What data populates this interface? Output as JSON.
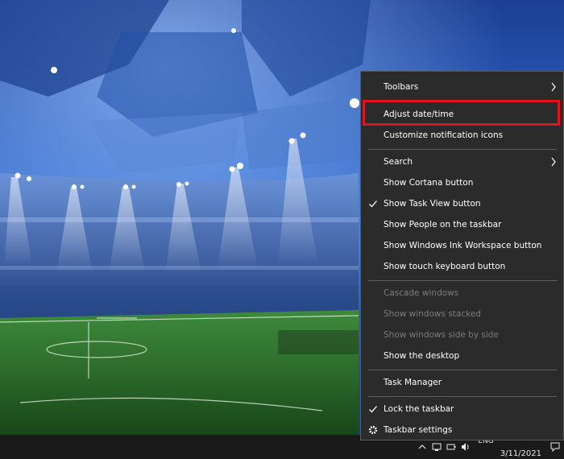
{
  "context_menu": {
    "items": [
      {
        "label": "Toolbars",
        "submenu": true
      },
      {
        "label": "Adjust date/time",
        "highlighted": true
      },
      {
        "label": "Customize notification icons"
      },
      {
        "label": "Search",
        "submenu": true
      },
      {
        "label": "Show Cortana button"
      },
      {
        "label": "Show Task View button",
        "checked": true
      },
      {
        "label": "Show People on the taskbar"
      },
      {
        "label": "Show Windows Ink Workspace button"
      },
      {
        "label": "Show touch keyboard button"
      },
      {
        "label": "Cascade windows",
        "disabled": true
      },
      {
        "label": "Show windows stacked",
        "disabled": true
      },
      {
        "label": "Show windows side by side",
        "disabled": true
      },
      {
        "label": "Show the desktop"
      },
      {
        "label": "Task Manager"
      },
      {
        "label": "Lock the taskbar",
        "checked": true
      },
      {
        "label": "Taskbar settings",
        "icon": "gear-icon"
      }
    ]
  },
  "taskbar": {
    "language": "ENG",
    "date": "3/11/2021"
  },
  "colors": {
    "menu_bg": "#2b2b2b",
    "highlight_border": "#e0141e",
    "disabled_text": "#7c7c7c",
    "taskbar_bg": "#1a1a1a"
  }
}
